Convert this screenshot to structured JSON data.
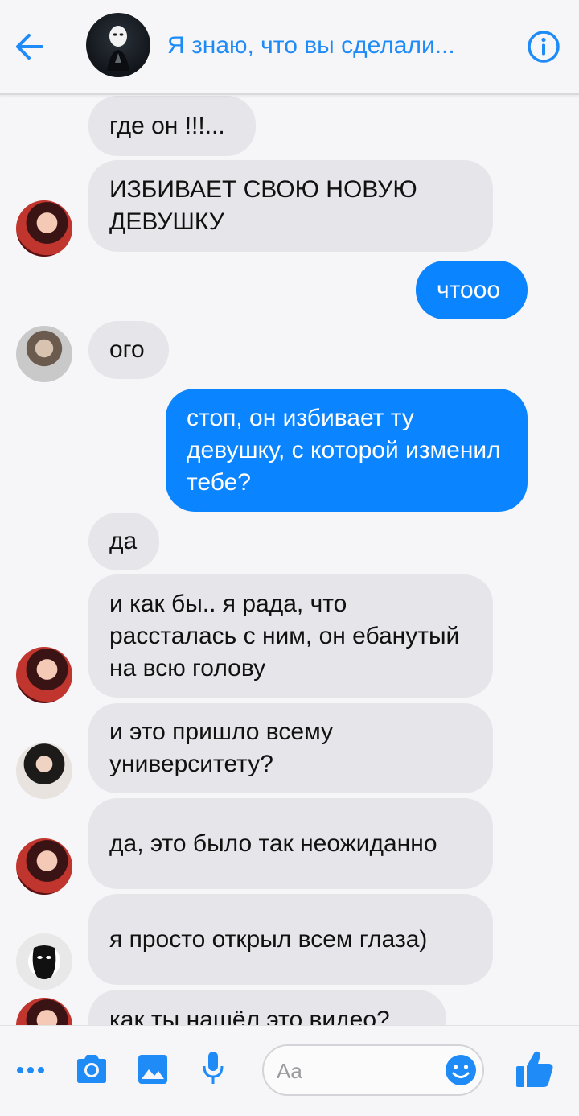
{
  "header": {
    "title": "Я знаю, что вы сделали..."
  },
  "messages": [
    {
      "side": "in",
      "text": "где он !!!...",
      "avatar": null
    },
    {
      "side": "in",
      "text": "ИЗБИВАЕТ СВОЮ НОВУЮ ДЕВУШКУ",
      "avatar": "girl-red"
    },
    {
      "side": "out",
      "text": "чтооо"
    },
    {
      "side": "in",
      "text": "ого",
      "avatar": "boy"
    },
    {
      "side": "out",
      "text": "стоп, он избивает ту девушку, с которой изменил тебе?"
    },
    {
      "side": "in",
      "text": "да",
      "avatar": null
    },
    {
      "side": "in",
      "text": "и как бы.. я рада, что рассталась с ним, он ебанутый на всю голову",
      "avatar": "girl-red"
    },
    {
      "side": "in",
      "text": "и это пришло всему университету?",
      "avatar": "girl-dark"
    },
    {
      "side": "in",
      "text": "да, это было так неожиданно",
      "avatar": "girl-red"
    },
    {
      "side": "in",
      "text": "я просто открыл всем глаза)",
      "avatar": "mask"
    },
    {
      "side": "in",
      "text": "как ты нашёл это видео?",
      "avatar": "girl-red"
    }
  ],
  "composer": {
    "placeholder": "Aa",
    "icons": [
      "more-icon",
      "camera-icon",
      "gallery-icon",
      "microphone-icon",
      "emoji-icon",
      "like-icon"
    ]
  },
  "colors": {
    "accent": "#1f8bf7",
    "outgoing_bubble": "#0a84ff",
    "incoming_bubble": "#e5e5ea"
  }
}
